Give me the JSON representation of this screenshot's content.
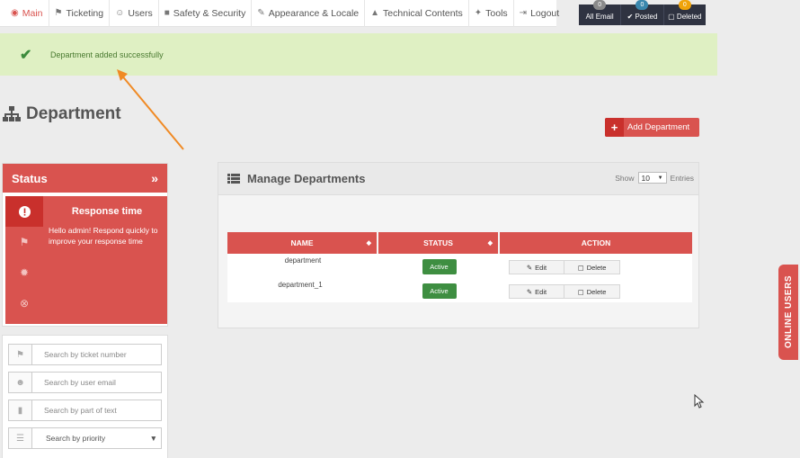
{
  "nav": {
    "items": [
      {
        "label": "Main",
        "icon": "◉"
      },
      {
        "label": "Ticketing",
        "icon": "🏷"
      },
      {
        "label": "Users",
        "icon": "👥"
      },
      {
        "label": "Safety & Security",
        "icon": "🔒"
      },
      {
        "label": "Appearance & Locale",
        "icon": "✎"
      },
      {
        "label": "Technical Contents",
        "icon": "🎓"
      },
      {
        "label": "Tools",
        "icon": "🔧"
      },
      {
        "label": "Logout",
        "icon": "⇥"
      }
    ]
  },
  "counters": [
    {
      "label": "All Email",
      "count": "0",
      "color": "#8a8a8a",
      "icon": ""
    },
    {
      "label": "Posted",
      "count": "0",
      "color": "#3a87ad",
      "icon": "✔"
    },
    {
      "label": "Deleted",
      "count": "0",
      "color": "#f0a30a",
      "icon": "🗑"
    }
  ],
  "alert": {
    "message": "Department added successfully",
    "icon": "check-icon"
  },
  "page": {
    "title": "Department",
    "add_button": "Add Department"
  },
  "status_panel": {
    "title": "Status",
    "response_title": "Response time",
    "response_text": "Hello admin! Respond quickly to improve your response time"
  },
  "search": {
    "ticket_placeholder": "Search by ticket number",
    "email_placeholder": "Search by user email",
    "text_placeholder": "Search by part of text",
    "priority_label": "Search by priority"
  },
  "manage": {
    "title": "Manage Departments",
    "show_label": "Show",
    "show_value": "10",
    "entries_label": "Entries",
    "columns": {
      "name": "NAME",
      "status": "STATUS",
      "action": "ACTION"
    },
    "rows": [
      {
        "name": "department",
        "status": "Active",
        "edit": "Edit",
        "delete": "Delete"
      },
      {
        "name": "department_1",
        "status": "Active",
        "edit": "Edit",
        "delete": "Delete"
      }
    ]
  },
  "online_users": {
    "label": "ONLINE USERS"
  },
  "colors": {
    "accent": "#d9534f",
    "success_bg": "#dff0c3",
    "active_green": "#3e8e41"
  }
}
